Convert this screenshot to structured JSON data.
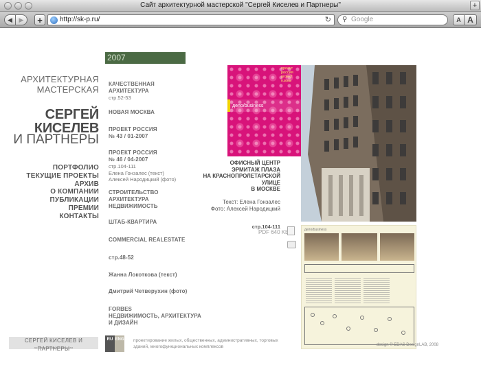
{
  "window": {
    "title": "Сайт архитектурной мастерской \"Сергей Киселев и Партнеры\""
  },
  "toolbar": {
    "url": "http://sk-p.ru/",
    "search_placeholder": "Google",
    "back_glyph": "◀",
    "forward_glyph": "▶",
    "add_glyph": "+",
    "reload_glyph": "↻",
    "font_small": "A",
    "font_big": "A",
    "resize_glyph": "+"
  },
  "brand": {
    "line1": "АРХИТЕКТУРНАЯ",
    "line2": "МАСТЕРСКАЯ",
    "line3": "СЕРГЕЙ",
    "line4": "КИСЕЛЕВ",
    "line5": "И ПАРТНЕРЫ"
  },
  "nav": [
    "ПОРТФОЛИО",
    "ТЕКУЩИЕ ПРОЕКТЫ",
    "АРХИВ",
    "О КОМПАНИИ",
    "ПУБЛИКАЦИИ",
    "ПРЕМИИ",
    "КОНТАКТЫ"
  ],
  "year": "2007",
  "issues": [
    {
      "title1": "КАЧЕСТВЕННАЯ",
      "title2": "АРХИТЕКТУРА",
      "sub1": "стр.52-53"
    },
    {
      "title1": "НОВАЯ МОСКВА"
    },
    {
      "title1": "ПРОЕКТ РОССИЯ",
      "title2": "№ 43 / 01-2007"
    },
    {
      "title1": "ПРОЕКТ РОССИЯ",
      "title2": "№ 46 / 04-2007",
      "sub1": "стр.104-111",
      "sub2": "Елена Гонзалес (текст)",
      "sub3": "Алексей Народицкий (фото)"
    },
    {
      "title1": "СТРОИТЕЛЬСТВО",
      "title2": "АРХИТЕКТУРА",
      "title3": "НЕДВИЖИМОСТЬ"
    },
    {
      "title1": "ШТАБ-КВАРТИРА"
    },
    {
      "title1": "COMMERCIAL REALESTATE"
    },
    {
      "title1": "стр.48-52"
    },
    {
      "title1": "Жанна Локоткова (текст)"
    },
    {
      "title1": "Дмитрий Четверухин (фото)"
    },
    {
      "title1": "FORBES",
      "title2": "НЕДВИЖИМОСТЬ, АРХИТЕКТУРА",
      "title3": "И ДИЗАЙН"
    }
  ],
  "magazine": {
    "logo": "дело/business",
    "words": [
      "проект",
      "россия",
      "project",
      "russia"
    ]
  },
  "article": {
    "title": [
      "ОФИСНЫЙ ЦЕНТР",
      "ЭРМИТАЖ ПЛАЗА",
      "НА КРАСНОПРОЛЕТАРСКОЙ",
      "УЛИЦЕ",
      "В МОСКВЕ"
    ],
    "credit1": "Текст: Елена Гонзалес",
    "credit2": "Фото: Алексей Народицкий",
    "pages": "стр.104-111"
  },
  "pdf": {
    "label": "PDF 640 Kb"
  },
  "scan": {
    "header": "дело/business"
  },
  "footer": {
    "logo": "СЕРГЕЙ  КИСЕЛЕВ  И  ПАРТНЕРЫ",
    "logo_small": "архитектурная мастерская",
    "lang_ru": "RU",
    "lang_eng": "ENG",
    "desc": "проектирование жилых, общественных, административных, торговых зданий, многофункциональных комплексов",
    "credit": "design © EDAS DesignLAB, 2008"
  },
  "colors": {
    "year_bar": "#4b6a44",
    "magazine": "#d8137a"
  }
}
